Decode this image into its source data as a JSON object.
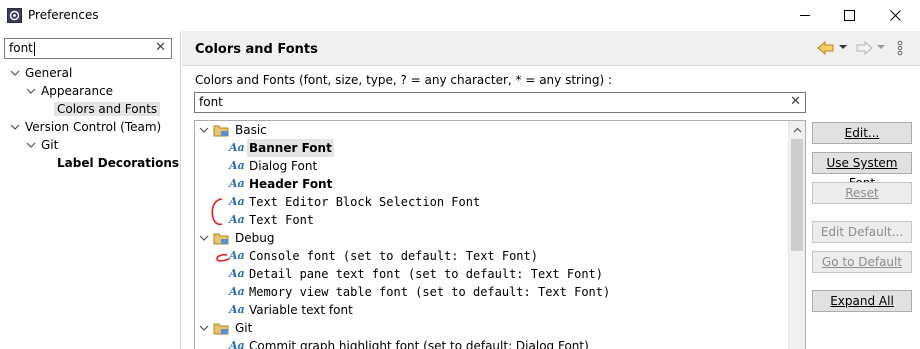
{
  "window": {
    "title": "Preferences",
    "controls": {
      "minimize": "—",
      "maximize": "☐",
      "close": "✕"
    }
  },
  "left": {
    "filter_value": "font",
    "filter_clear": "✕",
    "tree": [
      {
        "label": "General",
        "level": 0,
        "expanded": true
      },
      {
        "label": "Appearance",
        "level": 1,
        "expanded": true
      },
      {
        "label": "Colors and Fonts",
        "level": 2,
        "selected": true
      },
      {
        "label": "Version Control (Team)",
        "level": 0,
        "expanded": true
      },
      {
        "label": "Git",
        "level": 1,
        "expanded": true
      },
      {
        "label": "Label Decorations",
        "level": 2,
        "bold": true
      }
    ]
  },
  "right": {
    "page_title": "Colors and Fonts",
    "description": "Colors and Fonts (font, size, type, ? = any character, * = any string) :",
    "search_value": "font",
    "search_clear": "✕",
    "aa_glyph": "Aa",
    "categories": [
      {
        "label": "Basic",
        "items": [
          {
            "label": "Banner Font",
            "style": "bold",
            "selected": true
          },
          {
            "label": "Dialog Font",
            "style": "normal"
          },
          {
            "label": "Header Font",
            "style": "bold"
          },
          {
            "label": "Text Editor Block Selection Font",
            "style": "mono"
          },
          {
            "label": "Text Font",
            "style": "mono"
          }
        ]
      },
      {
        "label": "Debug",
        "items": [
          {
            "label": "Console font (set to default: Text Font)",
            "style": "mono"
          },
          {
            "label": "Detail pane text font (set to default: Text Font)",
            "style": "mono"
          },
          {
            "label": "Memory view table font (set to default: Text Font)",
            "style": "mono"
          },
          {
            "label": "Variable text font",
            "style": "normal"
          }
        ]
      },
      {
        "label": "Git",
        "items": [
          {
            "label": "Commit graph highlight font (set to default: Dialog Font)",
            "style": "normal"
          }
        ]
      }
    ],
    "buttons": [
      {
        "label": "Edit...",
        "enabled": true
      },
      {
        "label": "Use System Font",
        "enabled": true
      },
      {
        "label": "Reset",
        "enabled": false
      },
      {
        "label": "Edit Default...",
        "enabled": false
      },
      {
        "label": "Go to Default",
        "enabled": false
      },
      {
        "label": "Expand All",
        "enabled": true
      }
    ]
  },
  "colors": {
    "aa_icon": "#2d6eb0",
    "annotation": "#e02020",
    "selection_bg": "#e4e4e4",
    "back_arrow": "#e8b53a"
  }
}
